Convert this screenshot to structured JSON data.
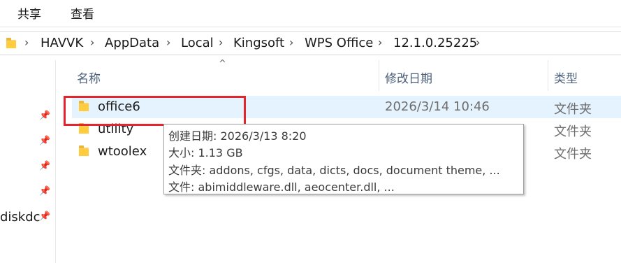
{
  "ribbon": {
    "tabs": [
      "共享",
      "查看"
    ]
  },
  "address": {
    "crumbs": [
      "HAVVK",
      "AppData",
      "Local",
      "Kingsoft",
      "WPS Office",
      "12.1.0.25225"
    ]
  },
  "nav": {
    "items": [
      {
        "label": "diskdc"
      }
    ]
  },
  "columns": {
    "name": "名称",
    "date": "修改日期",
    "type": "类型"
  },
  "files": [
    {
      "name": "office6",
      "date": "2026/3/14 10:46",
      "type": "文件夹"
    },
    {
      "name": "utility",
      "date": "",
      "type": "文件夹"
    },
    {
      "name": "wtoolex",
      "date": "",
      "type": "文件夹"
    }
  ],
  "tooltip": {
    "created": "创建日期: 2026/3/13 8:20",
    "size": "大小: 1.13 GB",
    "folders": "文件夹: addons, cfgs, data, dicts, docs, document theme, ...",
    "files": "文件: abimiddleware.dll, aeocenter.dll, ..."
  },
  "colors": {
    "selected_row": "#e5f3ff",
    "highlight": "#e3262d",
    "folder": "#ffcc3e"
  }
}
